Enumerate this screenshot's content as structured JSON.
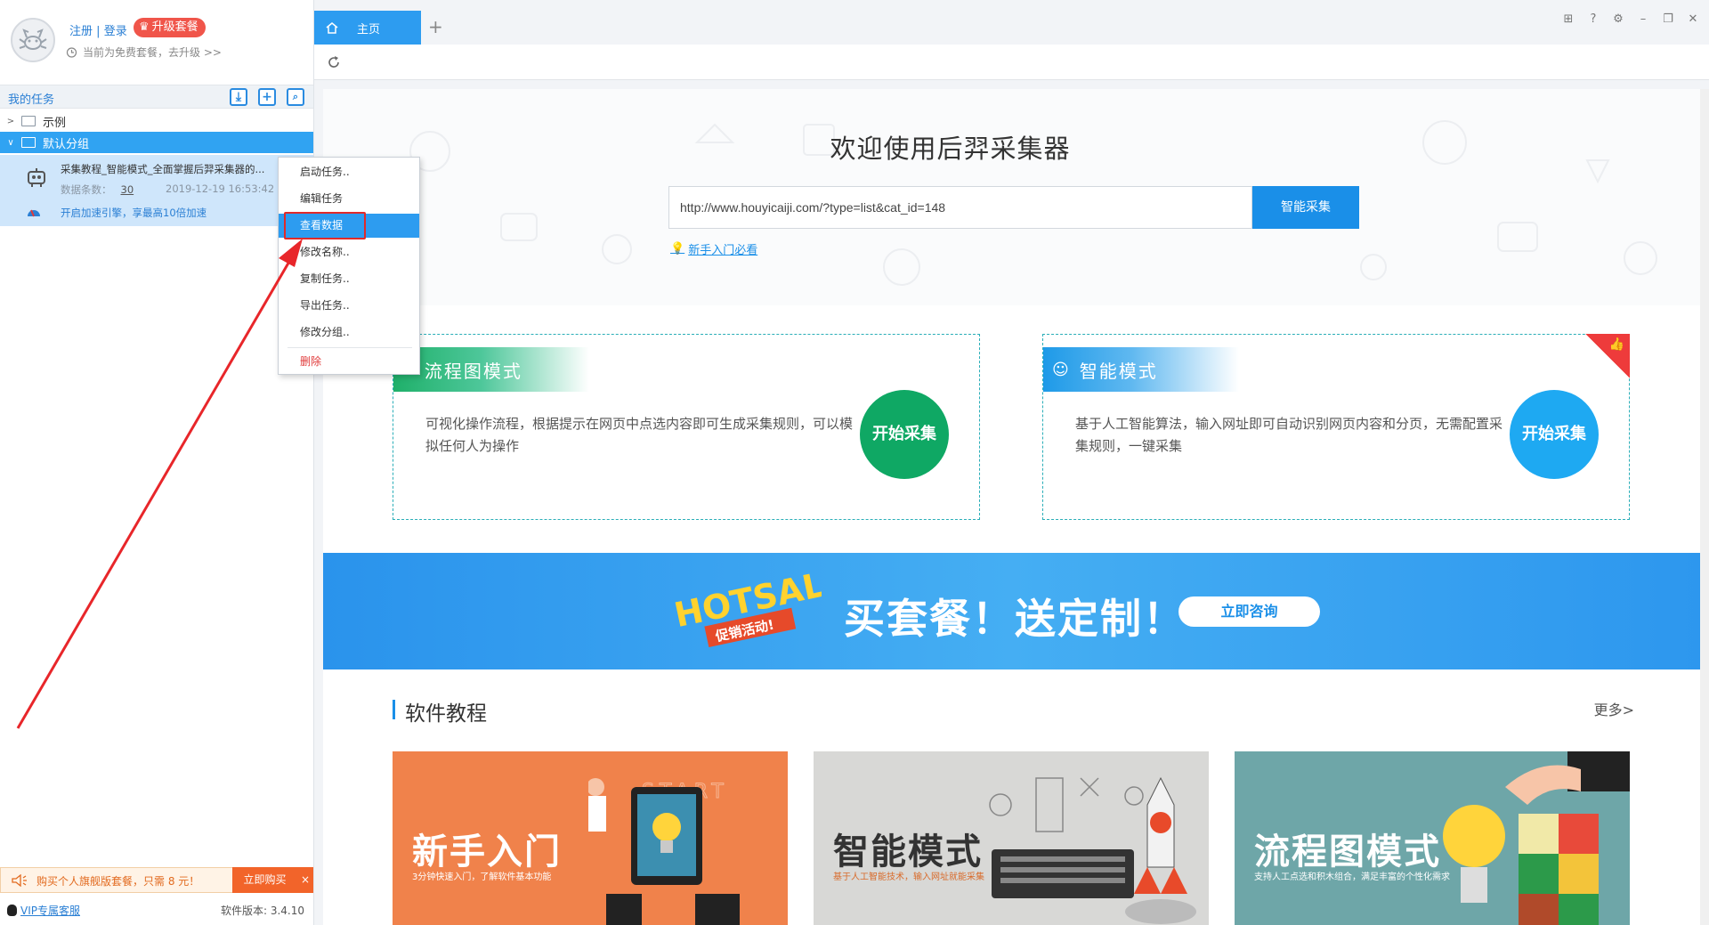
{
  "sidebar": {
    "login": {
      "register": "注册",
      "separator": "|",
      "login": "登录"
    },
    "upgrade_label": "升级套餐",
    "plan_note": "当前为免费套餐，去升级 >>",
    "task_header_title": "我的任务",
    "tree": [
      {
        "label": "示例",
        "expanded": false
      },
      {
        "label": "默认分组",
        "expanded": true
      }
    ],
    "task": {
      "title": "采集教程_智能模式_全面掌握后羿采集器的...",
      "count_label": "数据条数：",
      "count_value": "30",
      "date": "2019-12-19 16:53:42",
      "boost": "开启加速引擎，享最高10倍加速"
    },
    "context_menu": [
      "启动任务..",
      "编辑任务",
      "查看数据",
      "修改名称..",
      "复制任务..",
      "导出任务..",
      "修改分组..",
      "删除"
    ],
    "promo": {
      "text": "购买个人旗舰版套餐，只需 8 元！",
      "buy": "立即购买",
      "close": "×"
    },
    "vip_link": "VIP专属客服",
    "version": "软件版本: 3.4.10"
  },
  "tabs": {
    "home": "主页",
    "add": "+"
  },
  "main": {
    "hero_title": "欢迎使用后羿采集器",
    "url_value": "http://www.houyicaiji.com/?type=list&cat_id=148",
    "smart_collect": "智能采集",
    "newbie_link": "新手入门必看",
    "cards": [
      {
        "title": "流程图模式",
        "desc": "可视化操作流程，根据提示在网页中点选内容即可生成采集规则，可以模拟任何人为操作",
        "button": "开始采集"
      },
      {
        "title": "智能模式",
        "desc": "基于人工智能算法，输入网址即可自动识别网页内容和分页，无需配置采集规则，一键采集",
        "button": "开始采集"
      }
    ],
    "banner": {
      "logo_top": "HOTSALE",
      "logo_bottom": "促销活动!",
      "text": "买套餐！送定制！",
      "button": "立即咨询"
    },
    "tutorial_title": "软件教程",
    "more": "更多>",
    "tutorials": [
      {
        "name": "新手入门",
        "sub": "3分钟快速入门，了解软件基本功能",
        "deco": "START"
      },
      {
        "name": "智能模式",
        "sub": "基于人工智能技术，输入网址就能采集"
      },
      {
        "name": "流程图模式",
        "sub": "支持人工点选和积木组合，满足丰富的个性化需求"
      }
    ]
  },
  "colors": {
    "accent": "#2d9cf0",
    "green": "#0fa864",
    "red": "#e02a2a",
    "orange": "#f0824b"
  }
}
